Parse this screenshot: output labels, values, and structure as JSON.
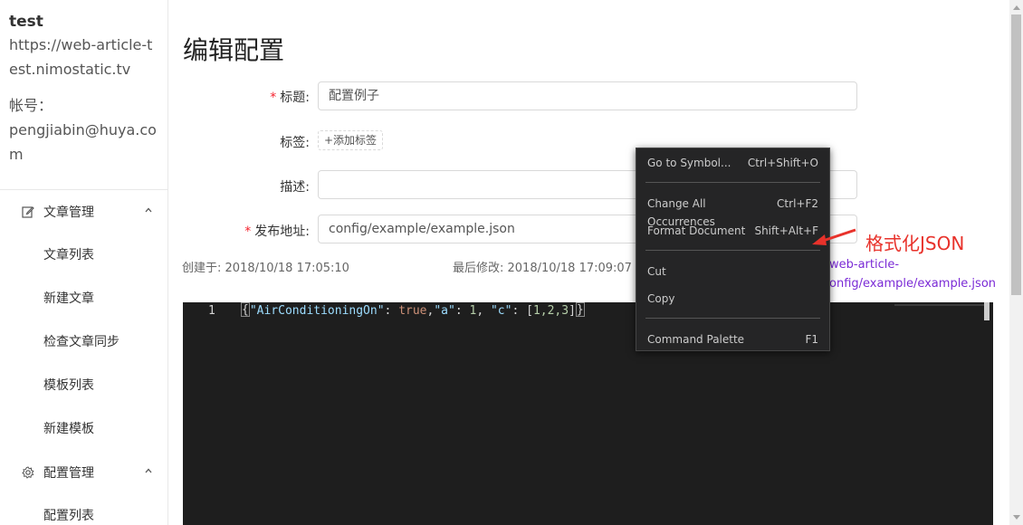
{
  "user": {
    "name": "test",
    "site": "https://web-article-test.nimostatic.tv",
    "account_label": "帐号：",
    "account": "pengjiabin@huya.com"
  },
  "sidebar": {
    "groups": [
      {
        "label": "文章管理",
        "icon": "edit-icon",
        "items": [
          {
            "label": "文章列表"
          },
          {
            "label": "新建文章"
          },
          {
            "label": "检查文章同步"
          },
          {
            "label": "模板列表"
          },
          {
            "label": "新建模板"
          }
        ]
      },
      {
        "label": "配置管理",
        "icon": "gear-icon",
        "items": [
          {
            "label": "配置列表"
          }
        ]
      }
    ]
  },
  "page": {
    "title": "编辑配置"
  },
  "form": {
    "title_label": "标题:",
    "title_value": "配置例子",
    "tags_label": "标签:",
    "add_tag": "+添加标签",
    "desc_label": "描述:",
    "desc_value": "",
    "publish_label": "发布地址:",
    "publish_value": "config/example/example.json"
  },
  "meta": {
    "created": "创建于:  2018/10/18 17:05:10",
    "modified": "最后修改:  2018/10/18 17:09:07",
    "url_line1": "web-article-",
    "url_line2": "onfig/example/example.json"
  },
  "editor": {
    "line": "1",
    "code": {
      "open": "{",
      "k1": "\"AirConditioningOn\"",
      "p1": ": ",
      "v1": "true",
      "p2": ",",
      "k2": "\"a\"",
      "p3": ": ",
      "v2": "1",
      "p4": ", ",
      "k3": "\"c\"",
      "p5": ": [",
      "v3": "1,2,3",
      "p6": "]",
      "close": "}"
    }
  },
  "context_menu": {
    "items": [
      {
        "label": "Go to Symbol...",
        "shortcut": "Ctrl+Shift+O"
      },
      {
        "label": "Change All Occurrences",
        "shortcut": "Ctrl+F2"
      },
      {
        "label": "Format Document",
        "shortcut": "Shift+Alt+F"
      },
      {
        "label": "Cut",
        "shortcut": ""
      },
      {
        "label": "Copy",
        "shortcut": ""
      },
      {
        "label": "Command Palette",
        "shortcut": "F1"
      }
    ]
  },
  "annotation": {
    "text": "格式化JSON",
    "color": "#e8322b"
  }
}
